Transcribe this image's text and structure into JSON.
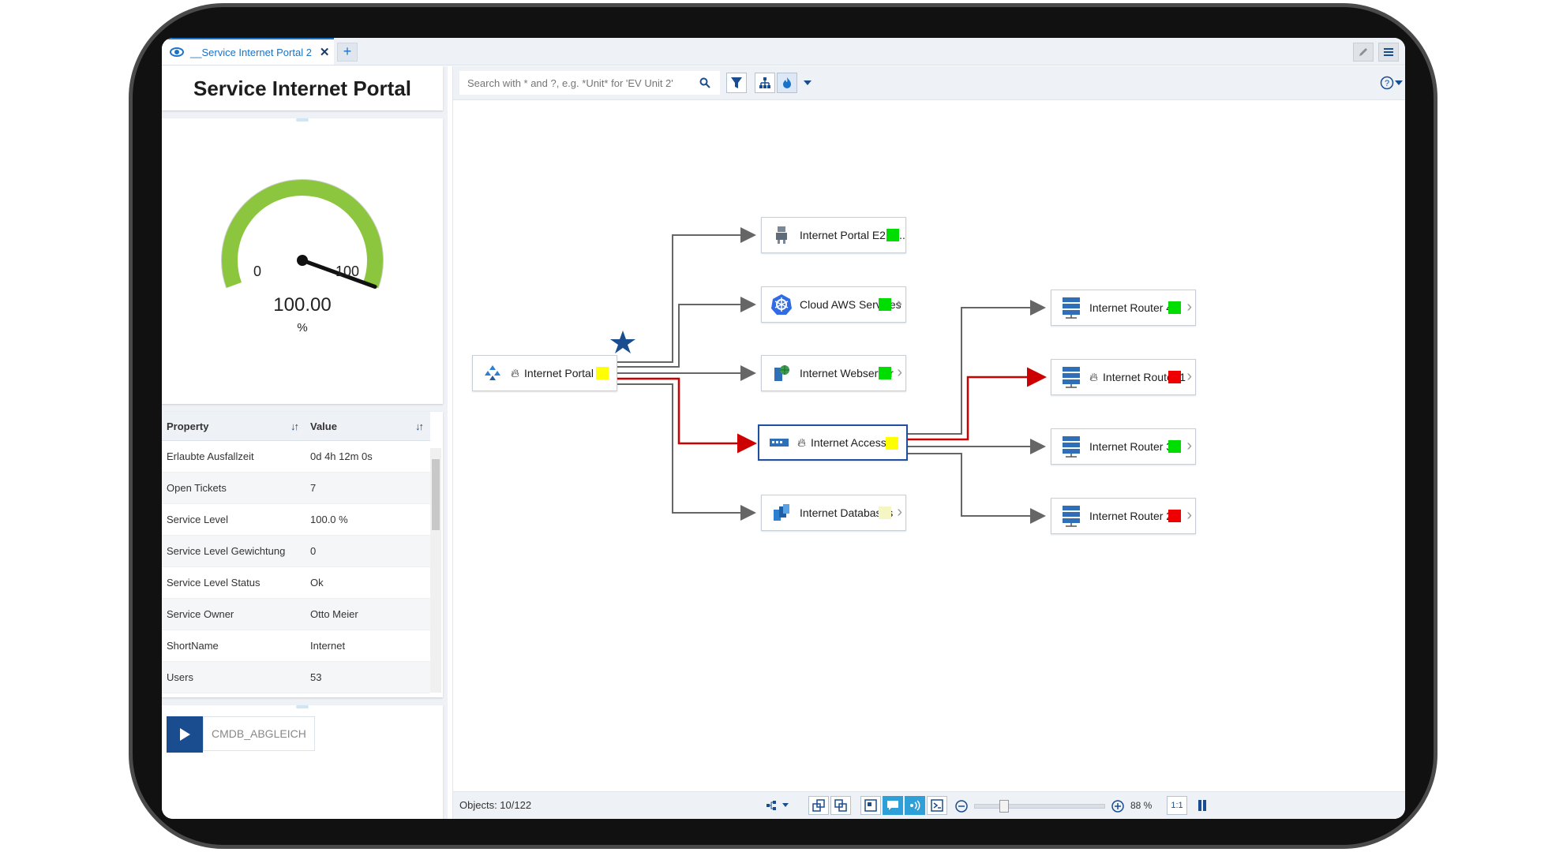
{
  "tabs": [
    {
      "label": "__Service Internet Portal 2"
    }
  ],
  "panel": {
    "title": "Service Internet Portal"
  },
  "gauge": {
    "min_label": "0",
    "max_label": "100",
    "value_text": "100.00",
    "unit": "%",
    "value": 100,
    "color": "#8cc63f"
  },
  "properties": {
    "headers": {
      "property": "Property",
      "value": "Value"
    },
    "rows": [
      {
        "property": "Erlaubte Ausfallzeit",
        "value": "0d 4h 12m 0s"
      },
      {
        "property": "Open Tickets",
        "value": "7"
      },
      {
        "property": "Service Level",
        "value": "100.0 %"
      },
      {
        "property": "Service Level Gewichtung",
        "value": "0"
      },
      {
        "property": "Service Level Status",
        "value": "Ok"
      },
      {
        "property": "Service Owner",
        "value": "Otto Meier"
      },
      {
        "property": "ShortName",
        "value": "Internet"
      },
      {
        "property": "Users",
        "value": "53"
      }
    ]
  },
  "action": {
    "label": "CMDB_ABGLEICH"
  },
  "search": {
    "placeholder": "Search with * and ?, e.g. *Unit* for 'EV Unit 2'"
  },
  "nodes": {
    "portal": {
      "label": "Internet Portal",
      "status": "#ffff00"
    },
    "e2e": {
      "label": "Internet Portal E2E ...",
      "status": "#00dd00"
    },
    "aws": {
      "label": "Cloud AWS Services",
      "status": "#00dd00"
    },
    "webserver": {
      "label": "Internet Webserver",
      "status": "#00dd00"
    },
    "access": {
      "label": "Internet Access",
      "status": "#ffff00"
    },
    "databases": {
      "label": "Internet Databases",
      "status": "#f6f6c4"
    },
    "router4": {
      "label": "Internet Router 4",
      "status": "#00dd00"
    },
    "router1": {
      "label": "Internet Router 1",
      "status": "#ee0000"
    },
    "router3": {
      "label": "Internet Router 3",
      "status": "#00dd00"
    },
    "router2": {
      "label": "Internet Router 2",
      "status": "#ee0000"
    }
  },
  "colors": {
    "critical_link": "#cc0000",
    "normal_link": "#666666",
    "accent": "#1a4d8f",
    "star": "#1a4d8f"
  },
  "status": {
    "objects": "Objects: 10/122",
    "zoom": "88 %",
    "zoom_value": 88,
    "fit_label": "1:1"
  }
}
